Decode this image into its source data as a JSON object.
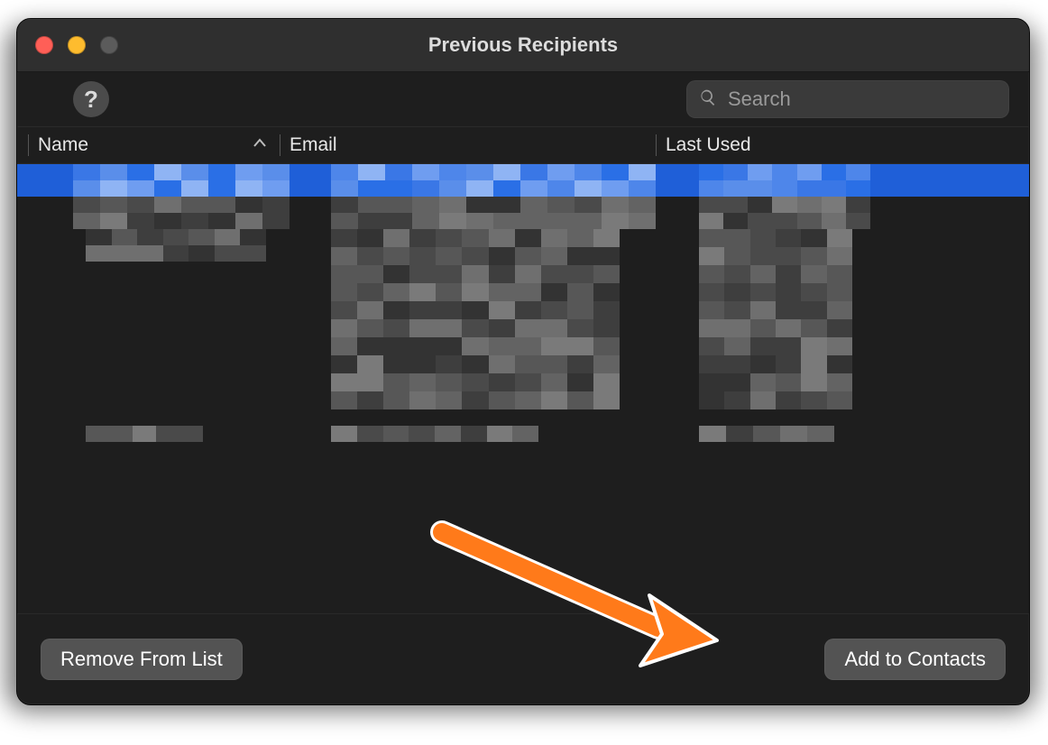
{
  "window": {
    "title": "Previous Recipients"
  },
  "toolbar": {
    "help_tooltip": "?",
    "search_placeholder": "Search"
  },
  "columns": {
    "name": "Name",
    "email": "Email",
    "last_used": "Last Used",
    "sort_column": "Name",
    "sort_direction": "ascending"
  },
  "footer": {
    "remove_label": "Remove From List",
    "add_label": "Add to Contacts"
  },
  "annotation": {
    "arrow_target": "add-to-contacts-button",
    "arrow_color": "#ff7a1a"
  }
}
